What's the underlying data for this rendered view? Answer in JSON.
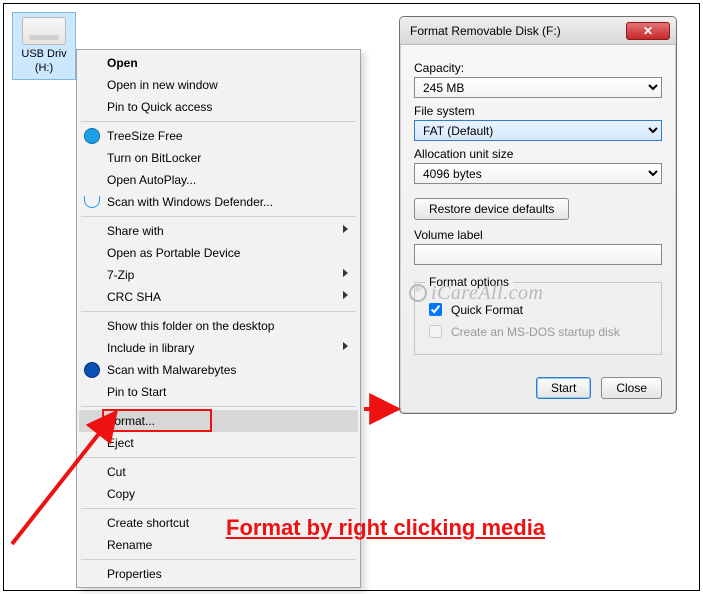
{
  "desktop": {
    "icon_label_line1": "USB Driv",
    "icon_label_line2": "(H:)"
  },
  "context_menu": {
    "items": [
      {
        "label": "Open",
        "bold": true
      },
      {
        "label": "Open in new window"
      },
      {
        "label": "Pin to Quick access"
      },
      {
        "sep": true
      },
      {
        "label": "TreeSize Free",
        "icon": "treesize"
      },
      {
        "label": "Turn on BitLocker"
      },
      {
        "label": "Open AutoPlay..."
      },
      {
        "label": "Scan with Windows Defender...",
        "icon": "defender"
      },
      {
        "sep": true
      },
      {
        "label": "Share with",
        "submenu": true
      },
      {
        "label": "Open as Portable Device"
      },
      {
        "label": "7-Zip",
        "submenu": true
      },
      {
        "label": "CRC SHA",
        "submenu": true
      },
      {
        "sep": true
      },
      {
        "label": "Show this folder on the desktop"
      },
      {
        "label": "Include in library",
        "submenu": true
      },
      {
        "label": "Scan with Malwarebytes",
        "icon": "malware"
      },
      {
        "label": "Pin to Start"
      },
      {
        "sep": true
      },
      {
        "label": "Format...",
        "highlighted": true
      },
      {
        "label": "Eject"
      },
      {
        "sep": true
      },
      {
        "label": "Cut"
      },
      {
        "label": "Copy"
      },
      {
        "sep": true
      },
      {
        "label": "Create shortcut"
      },
      {
        "label": "Rename"
      },
      {
        "sep": true
      },
      {
        "label": "Properties"
      }
    ]
  },
  "format_dialog": {
    "title": "Format Removable Disk (F:)",
    "capacity_label": "Capacity:",
    "capacity_value": "245 MB",
    "filesystem_label": "File system",
    "filesystem_value": "FAT (Default)",
    "allocunit_label": "Allocation unit size",
    "allocunit_value": "4096 bytes",
    "restore_label": "Restore device defaults",
    "volume_label_caption": "Volume label",
    "volume_label_value": "",
    "options_legend": "Format options",
    "quick_format_label": "Quick Format",
    "quick_format_checked": true,
    "msdos_label": "Create an MS-DOS startup disk",
    "msdos_checked": false,
    "start_label": "Start",
    "close_label": "Close"
  },
  "annotation": {
    "caption": "Format by right clicking media",
    "watermark": "iCareAll.com"
  }
}
